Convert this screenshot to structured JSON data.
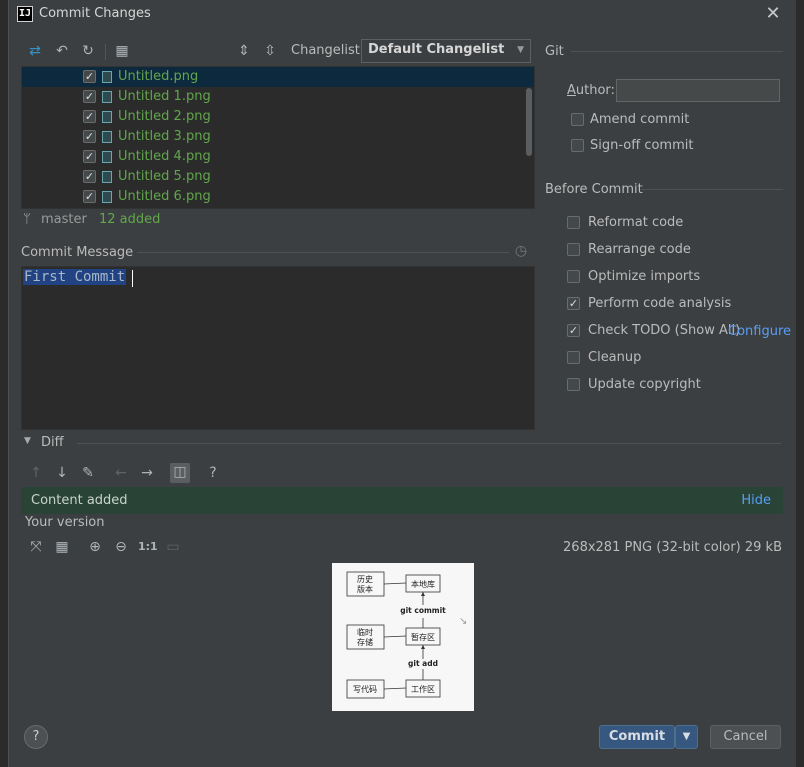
{
  "window": {
    "title": "Commit Changes",
    "app_icon_text": "IJ"
  },
  "toolbar": {
    "changelist_label": "Changelist:",
    "changelist_value": "Default Changelist"
  },
  "files": [
    {
      "name": "Untitled.png",
      "checked": true
    },
    {
      "name": "Untitled 1.png",
      "checked": true
    },
    {
      "name": "Untitled 2.png",
      "checked": true
    },
    {
      "name": "Untitled 3.png",
      "checked": true
    },
    {
      "name": "Untitled 4.png",
      "checked": true
    },
    {
      "name": "Untitled 5.png",
      "checked": true
    },
    {
      "name": "Untitled 6.png",
      "checked": true
    }
  ],
  "status": {
    "branch": "master",
    "added": "12 added"
  },
  "commit_message": {
    "label": "Commit Message",
    "text": "First Commit"
  },
  "git": {
    "title": "Git",
    "author_label": "Author:",
    "author_value": "",
    "amend_label": "Amend commit",
    "signoff_label": "Sign-off commit"
  },
  "before_commit": {
    "title": "Before Commit",
    "options": [
      {
        "label": "Reformat code",
        "checked": false
      },
      {
        "label": "Rearrange code",
        "checked": false
      },
      {
        "label": "Optimize imports",
        "checked": false
      },
      {
        "label": "Perform code analysis",
        "checked": true
      },
      {
        "label": "Check TODO (Show All)",
        "checked": true
      },
      {
        "label": "Cleanup",
        "checked": false
      },
      {
        "label": "Update copyright",
        "checked": false
      }
    ],
    "configure_link": "Configure"
  },
  "diff": {
    "title": "Diff",
    "notice": "Content added",
    "hide_link": "Hide",
    "your_version": "Your version",
    "zoom_label": "1:1",
    "image_info": "268x281 PNG (32-bit color) 29 kB"
  },
  "preview_image": {
    "box1": "历史\n版本",
    "box2": "本地库",
    "arrow1": "git commit",
    "box3": "临时\n存储",
    "box4": "暂存区",
    "arrow2": "git add",
    "box5": "写代码",
    "box6": "工作区"
  },
  "buttons": {
    "commit": "Commit",
    "cancel": "Cancel",
    "help": "?"
  },
  "colors": {
    "accent": "#3592c4",
    "added_green": "#62a64c",
    "link": "#589df6"
  }
}
